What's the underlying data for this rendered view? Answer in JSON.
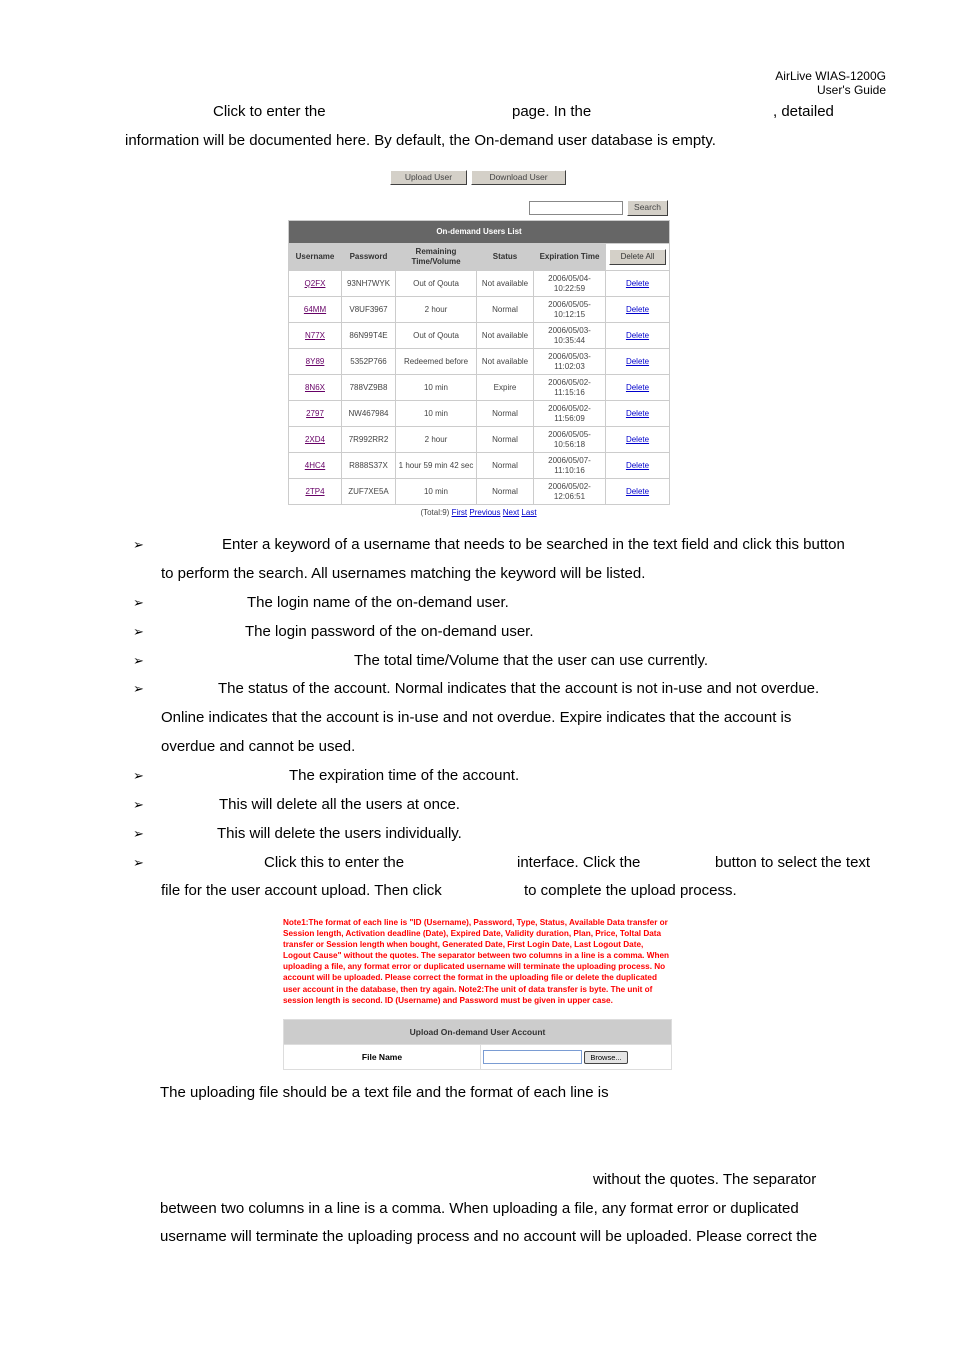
{
  "header": {
    "product": "AirLive  WIAS-1200G",
    "guide": "User's  Guide"
  },
  "intro": {
    "l1a": "Click to enter the",
    "l1b": "page. In the",
    "l1c": ", detailed",
    "l2": "information will be documented here. By default, the On-demand user database is empty."
  },
  "screenshot": {
    "upload_btn": "Upload User",
    "download_btn": "Download User",
    "search_btn": "Search",
    "search_value": "",
    "title": "On-demand Users List",
    "columns": [
      "Username",
      "Password",
      "Remaining Time/Volume",
      "Status",
      "Expiration Time"
    ],
    "delete_all": "Delete All",
    "rows": [
      [
        "Q2FX",
        "93NH7WYK",
        "Out of Qouta",
        "Not available",
        "2006/05/04-10:22:59"
      ],
      [
        "64MM",
        "V8UF3967",
        "2 hour",
        "Normal",
        "2006/05/05-10:12:15"
      ],
      [
        "N77X",
        "86N99T4E",
        "Out of Qouta",
        "Not available",
        "2006/05/03-10:35:44"
      ],
      [
        "8Y89",
        "5352P766",
        "Redeemed before",
        "Not available",
        "2006/05/03-11:02:03"
      ],
      [
        "8N6X",
        "788VZ9B8",
        "10 min",
        "Expire",
        "2006/05/02-11:15:16"
      ],
      [
        "2797",
        "NW467984",
        "10 min",
        "Normal",
        "2006/05/02-11:56:09"
      ],
      [
        "2XD4",
        "7R992RR2",
        "2 hour",
        "Normal",
        "2006/05/05-10:56:18"
      ],
      [
        "4HC4",
        "R888S37X",
        "1 hour 59 min 42 sec",
        "Normal",
        "2006/05/07-11:10:16"
      ],
      [
        "2TP4",
        "ZUF7XE5A",
        "10 min",
        "Normal",
        "2006/05/02-12:06:51"
      ]
    ],
    "delete_label": "Delete",
    "total": "(Total:9)",
    "first": "First",
    "previous": "Previous",
    "next": "Next",
    "last": "Last"
  },
  "bullets": {
    "b1a": "Enter a keyword of a username that needs to be searched in the text field and click this button",
    "b1b": "to perform the search. All usernames matching the keyword will be listed.",
    "b2": "The login name of the on-demand user.",
    "b3": "The login password of the on-demand user.",
    "b4": "The total time/Volume that the user can use currently.",
    "b5a": "The status of the account. Normal indicates that the account is not in-use and not overdue.",
    "b5b": "Online indicates that the account is in-use and not overdue. Expire indicates that the account is",
    "b5c": "overdue and cannot be used.",
    "b6": "The expiration time of the account.",
    "b7": "This will delete all the users at once.",
    "b8": "This will delete the users individually.",
    "b9a": "Click this to enter the",
    "b9b": "interface. Click the",
    "b9c": "button to select the text",
    "b9d": "file for the user account upload. Then click",
    "b9e": "to complete the upload process."
  },
  "upload": {
    "note": "Note1:The format of each line is \"ID (Username), Password, Type, Status, Available Data transfer or Session length, Activation deadline (Date), Expired Date, Validity duration, Plan, Price, Toltal Data transfer or Session length when bought, Generated Date, First Login Date, Last Logout Date, Logout Cause\" without the quotes. The separator between two columns in a line is a comma. When uploading a file, any format error or duplicated username will terminate the uploading process. No account will be uploaded. Please correct the format in the uploading file or delete the duplicated user account in the database, then try again. Note2:The unit of data transfer is byte. The unit of session length is second. ID (Username) and Password must be given in upper case.",
    "title": "Upload On-demand User Account",
    "file_label": "File Name",
    "browse": "Browse...",
    "file_value": ""
  },
  "outro": {
    "l1": "The uploading file should be a text file and the format of each line is",
    "l2": "without the quotes. The separator",
    "l3": "between two columns in a line is a comma. When uploading a file, any format error or duplicated",
    "l4": "username will terminate the uploading process and no account will be uploaded. Please correct the"
  }
}
